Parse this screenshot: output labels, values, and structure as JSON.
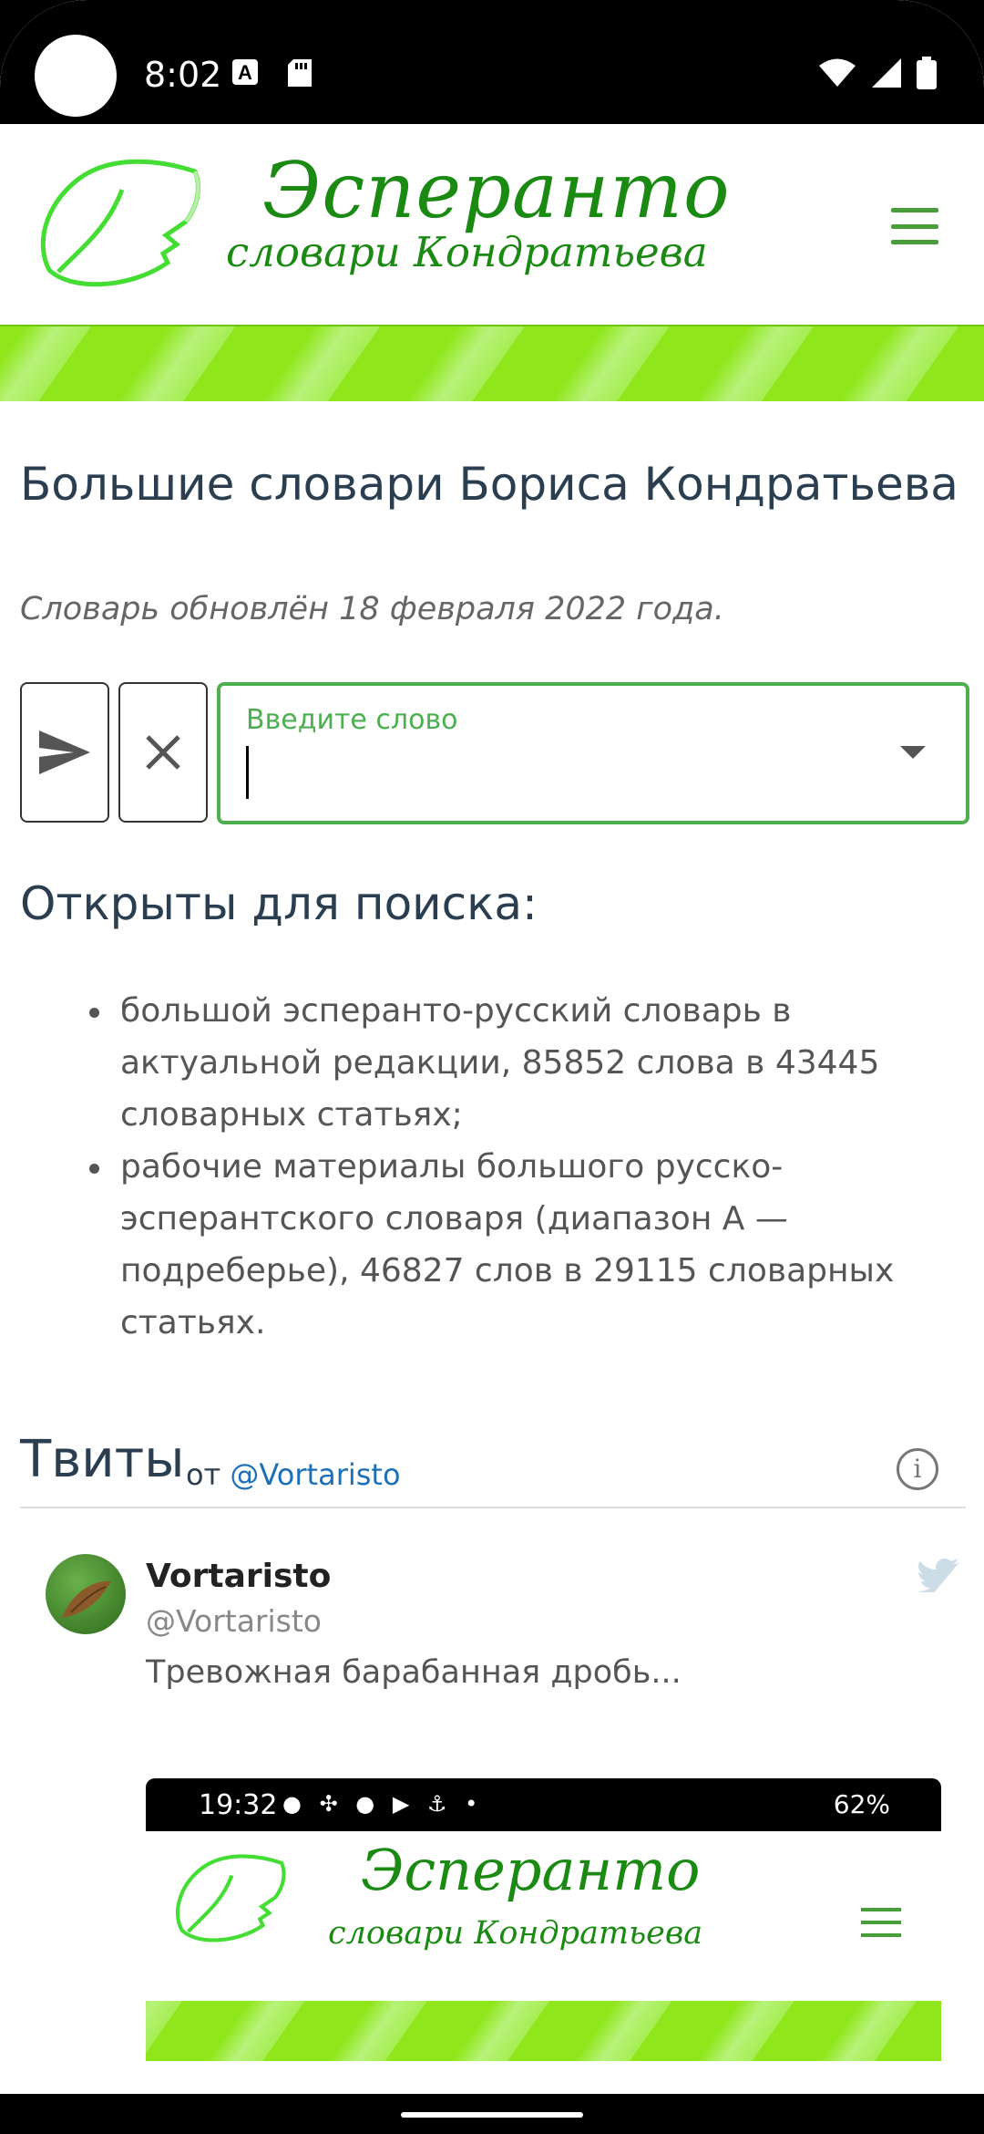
{
  "status_bar": {
    "time": "8:02",
    "icons": [
      "a-accessibility-icon",
      "sd-card-icon",
      "wifi-icon",
      "signal-icon",
      "battery-icon"
    ]
  },
  "header": {
    "brand_title": "Эсперанто",
    "brand_subtitle": "словари Кондратьева",
    "menu_icon": "hamburger-menu-icon"
  },
  "main": {
    "page_title": "Большие словари Бориса Кондратьева",
    "updated_note": "Словарь обновлён 18 февраля 2022 года.",
    "search": {
      "label": "Введите слово",
      "value": "",
      "send_icon": "send-icon",
      "clear_icon": "close-icon",
      "dropdown_icon": "caret-down-icon"
    },
    "open_heading": "Открыты для поиска:",
    "dictionaries": [
      "большой эсперанто-русский словарь в актуальной редакции, 85852 слова в 43445 словарных статьях;",
      "рабочие материалы большого русско-эсперантского словаря (диапазон А — подреберье), 46827 слов в 29115 словарных статьях."
    ]
  },
  "tweets": {
    "title": "Твиты",
    "by_prefix": "от",
    "by_handle": "@Vortaristo",
    "info_icon": "info-icon",
    "items": [
      {
        "name": "Vortaristo",
        "handle": "@Vortaristo",
        "text": "Тревожная барабанная дробь...",
        "bird_icon": "twitter-bird-icon"
      }
    ],
    "embedded_image": {
      "time": "19:32",
      "battery": "62%",
      "brand_title": "Эсперанто",
      "brand_subtitle": "словари Кондратьева"
    }
  },
  "colors": {
    "brand_green": "#1a8a12",
    "accent_green": "#4caf50",
    "band_green": "#8fe61a",
    "heading": "#2b3e50",
    "link": "#1d6fb8"
  }
}
